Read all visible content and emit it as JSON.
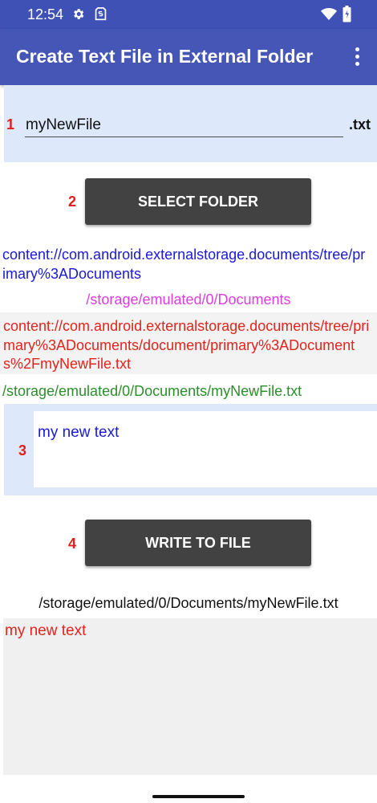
{
  "status_bar": {
    "time": "12:54",
    "icons": [
      "gear-icon",
      "sim-icon",
      "wifi-icon",
      "battery-icon"
    ]
  },
  "app_bar": {
    "title": "Create Text File in External Folder",
    "menu_icon": "more-vertical-icon",
    "color": "#4556b6"
  },
  "step1": {
    "number": "1",
    "filename_value": "myNewFile",
    "extension": ".txt"
  },
  "step2": {
    "number": "2",
    "button_label": "SELECT FOLDER"
  },
  "info": {
    "tree_uri": "content://com.android.externalstorage.documents/tree/primary%3ADocuments",
    "folder_path": "/storage/emulated/0/Documents",
    "document_uri": "content://com.android.externalstorage.documents/tree/primary%3ADocuments/document/primary%3ADocuments%2FmyNewFile.txt",
    "file_path": "/storage/emulated/0/Documents/myNewFile.txt"
  },
  "step3": {
    "number": "3",
    "text_value": "my new text"
  },
  "step4": {
    "number": "4",
    "button_label": "WRITE TO FILE"
  },
  "result": {
    "file_path": "/storage/emulated/0/Documents/myNewFile.txt",
    "content": "my new text"
  },
  "colors": {
    "step_number": "#e0201b",
    "panel_bg": "#dde9fb",
    "button_bg": "#424242",
    "tree_uri": "#1a1ad6",
    "folder_path": "#dd3ddd",
    "document_uri": "#e0251d",
    "file_path": "#2a8f2a"
  }
}
